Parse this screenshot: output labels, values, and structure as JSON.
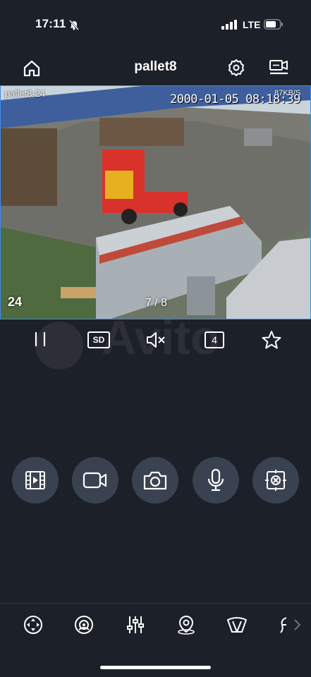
{
  "status_bar": {
    "time": "17:11",
    "network": "LTE"
  },
  "nav": {
    "title": "pallet8"
  },
  "video": {
    "camera_name": "pallet8-24",
    "timestamp": "2000-01-05 08:18:39",
    "bitrate": "87KB/S",
    "channel_number": "24",
    "page_indicator": "7 / 8"
  },
  "controls": {
    "quality_label": "SD",
    "split_label": "4"
  },
  "watermark": {
    "text": "Avito"
  },
  "actions": [
    {
      "icon": "video-playback-icon"
    },
    {
      "icon": "record-video-icon"
    },
    {
      "icon": "snapshot-camera-icon"
    },
    {
      "icon": "microphone-icon"
    },
    {
      "icon": "cancel-frame-icon"
    }
  ],
  "tools": [
    {
      "icon": "ptz-direction-icon"
    },
    {
      "icon": "eye-view-icon"
    },
    {
      "icon": "sliders-adjust-icon"
    },
    {
      "icon": "location-target-icon"
    },
    {
      "icon": "wiper-icon"
    },
    {
      "icon": "more-tool-icon"
    }
  ],
  "colors": {
    "background": "#1c2028",
    "button_bg": "#3a4252",
    "accent_border": "#3d8ce6"
  }
}
